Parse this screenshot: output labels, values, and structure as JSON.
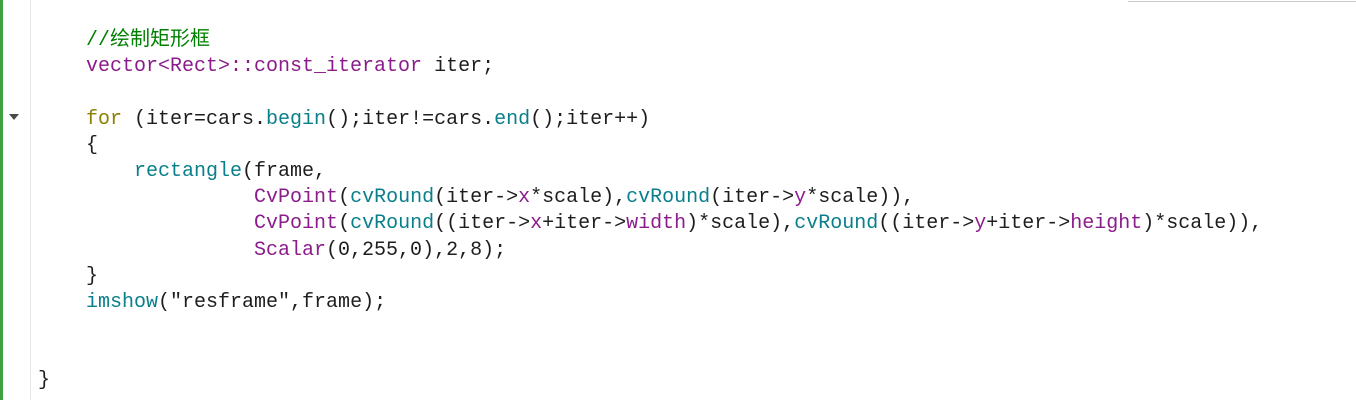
{
  "colors": {
    "plain": "#1e1e1e",
    "comment": "#008000",
    "keyword": "#8b8000",
    "type": "#8b1c8b",
    "member": "#8b1c8b",
    "function": "#0a7f8c",
    "change_bar": "#3da23d",
    "gutter_border": "#e4e4e4"
  },
  "icons": {
    "fold_toggle": "triangle-down-icon"
  },
  "code": {
    "lines": [
      {
        "tokens": [
          {
            "k": "comment",
            "text": "    //绘制矩形框"
          }
        ]
      },
      {
        "tokens": [
          {
            "k": "type",
            "text": "    vector<Rect>::const_iterator"
          },
          {
            "k": "plain",
            "text": " iter;"
          }
        ]
      },
      {
        "tokens": []
      },
      {
        "tokens": [
          {
            "k": "keyword",
            "text": "    for"
          },
          {
            "k": "plain",
            "text": " (iter=cars."
          },
          {
            "k": "function",
            "text": "begin"
          },
          {
            "k": "plain",
            "text": "();iter!=cars."
          },
          {
            "k": "function",
            "text": "end"
          },
          {
            "k": "plain",
            "text": "();iter++)"
          }
        ]
      },
      {
        "tokens": [
          {
            "k": "plain",
            "text": "    {"
          }
        ]
      },
      {
        "tokens": [
          {
            "k": "function",
            "text": "        rectangle"
          },
          {
            "k": "plain",
            "text": "(frame,"
          }
        ]
      },
      {
        "tokens": [
          {
            "k": "type",
            "text": "                  CvPoint"
          },
          {
            "k": "plain",
            "text": "("
          },
          {
            "k": "function",
            "text": "cvRound"
          },
          {
            "k": "plain",
            "text": "(iter->"
          },
          {
            "k": "member",
            "text": "x"
          },
          {
            "k": "plain",
            "text": "*scale),"
          },
          {
            "k": "function",
            "text": "cvRound"
          },
          {
            "k": "plain",
            "text": "(iter->"
          },
          {
            "k": "member",
            "text": "y"
          },
          {
            "k": "plain",
            "text": "*scale)),"
          }
        ]
      },
      {
        "tokens": [
          {
            "k": "type",
            "text": "                  CvPoint"
          },
          {
            "k": "plain",
            "text": "("
          },
          {
            "k": "function",
            "text": "cvRound"
          },
          {
            "k": "plain",
            "text": "((iter->"
          },
          {
            "k": "member",
            "text": "x"
          },
          {
            "k": "plain",
            "text": "+iter->"
          },
          {
            "k": "member",
            "text": "width"
          },
          {
            "k": "plain",
            "text": ")*scale),"
          },
          {
            "k": "function",
            "text": "cvRound"
          },
          {
            "k": "plain",
            "text": "((iter->"
          },
          {
            "k": "member",
            "text": "y"
          },
          {
            "k": "plain",
            "text": "+iter->"
          },
          {
            "k": "member",
            "text": "height"
          },
          {
            "k": "plain",
            "text": ")*scale)),"
          }
        ]
      },
      {
        "tokens": [
          {
            "k": "type",
            "text": "                  Scalar"
          },
          {
            "k": "plain",
            "text": "(0,255,0),2,8);"
          }
        ]
      },
      {
        "tokens": [
          {
            "k": "plain",
            "text": "    }"
          }
        ]
      },
      {
        "tokens": [
          {
            "k": "function",
            "text": "    imshow"
          },
          {
            "k": "plain",
            "text": "(\"resframe\",frame);"
          }
        ]
      },
      {
        "tokens": []
      },
      {
        "tokens": []
      },
      {
        "tokens": [
          {
            "k": "plain",
            "text": "}"
          }
        ]
      }
    ]
  }
}
